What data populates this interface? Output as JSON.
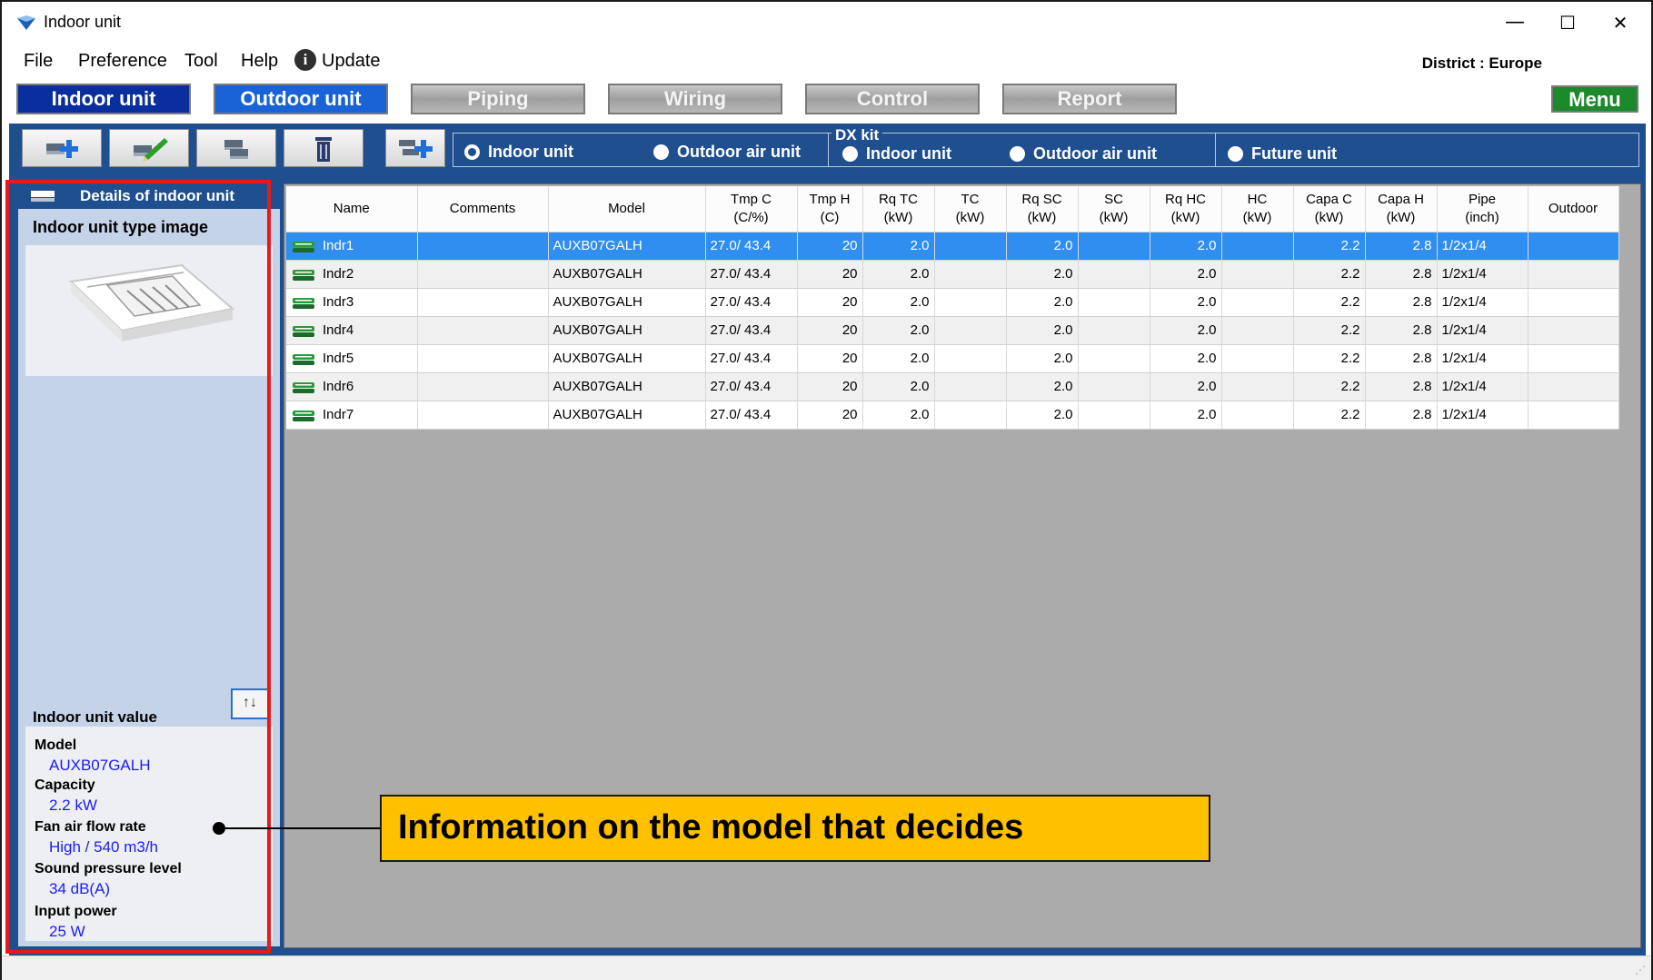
{
  "window": {
    "title": "Indoor unit",
    "controls": {
      "minimize": "—",
      "maximize": "☐",
      "close": "✕"
    }
  },
  "menubar": {
    "items": [
      "File",
      "Preference",
      "Tool",
      "Help",
      "Update"
    ],
    "update_icon": "info-icon",
    "district": "District : Europe"
  },
  "nav": {
    "tabs": [
      {
        "label": "Indoor unit",
        "state": "active"
      },
      {
        "label": "Outdoor unit",
        "state": "enabled"
      },
      {
        "label": "Piping",
        "state": "disabled"
      },
      {
        "label": "Wiring",
        "state": "disabled"
      },
      {
        "label": "Control",
        "state": "disabled"
      },
      {
        "label": "Report",
        "state": "disabled"
      }
    ],
    "menu_label": "Menu"
  },
  "toolbar": {
    "buttons": [
      "add-unit-icon",
      "edit-unit-icon",
      "copy-unit-icon",
      "delete-icon",
      "add-multiple-icon"
    ],
    "dx_kit_label": "DX kit",
    "radios": [
      {
        "label": "Indoor unit",
        "checked": true
      },
      {
        "label": "Outdoor air unit",
        "checked": false
      },
      {
        "label": "Indoor unit",
        "checked": false
      },
      {
        "label": "Outdoor air unit",
        "checked": false
      },
      {
        "label": "Future unit",
        "checked": false
      }
    ]
  },
  "details": {
    "title": "Details of indoor unit",
    "type_image_label": "Indoor unit type image",
    "value_label": "Indoor unit value",
    "sort_icon": "↑↓",
    "values": [
      {
        "label": "Model",
        "value": "AUXB07GALH"
      },
      {
        "label": "Capacity",
        "value": "2.2 kW"
      },
      {
        "label": "Fan air flow rate",
        "value": "High / 540 m3/h"
      },
      {
        "label": "Sound pressure level",
        "value": "34 dB(A)"
      },
      {
        "label": "Input power",
        "value": "25 W"
      }
    ]
  },
  "grid": {
    "columns": [
      {
        "line1": "Name",
        "line2": ""
      },
      {
        "line1": "Comments",
        "line2": ""
      },
      {
        "line1": "Model",
        "line2": ""
      },
      {
        "line1": "Tmp C",
        "line2": "(C/%)"
      },
      {
        "line1": "Tmp H",
        "line2": "(C)"
      },
      {
        "line1": "Rq TC",
        "line2": "(kW)"
      },
      {
        "line1": "TC",
        "line2": "(kW)"
      },
      {
        "line1": "Rq SC",
        "line2": "(kW)"
      },
      {
        "line1": "SC",
        "line2": "(kW)"
      },
      {
        "line1": "Rq HC",
        "line2": "(kW)"
      },
      {
        "line1": "HC",
        "line2": "(kW)"
      },
      {
        "line1": "Capa C",
        "line2": "(kW)"
      },
      {
        "line1": "Capa H",
        "line2": "(kW)"
      },
      {
        "line1": "Pipe",
        "line2": "(inch)"
      },
      {
        "line1": "Outdoor",
        "line2": ""
      }
    ],
    "rows": [
      [
        "Indr1",
        "",
        "AUXB07GALH",
        "27.0/ 43.4",
        "20",
        "2.0",
        "",
        "2.0",
        "",
        "2.0",
        "",
        "2.2",
        "2.8",
        "1/2x1/4",
        ""
      ],
      [
        "Indr2",
        "",
        "AUXB07GALH",
        "27.0/ 43.4",
        "20",
        "2.0",
        "",
        "2.0",
        "",
        "2.0",
        "",
        "2.2",
        "2.8",
        "1/2x1/4",
        ""
      ],
      [
        "Indr3",
        "",
        "AUXB07GALH",
        "27.0/ 43.4",
        "20",
        "2.0",
        "",
        "2.0",
        "",
        "2.0",
        "",
        "2.2",
        "2.8",
        "1/2x1/4",
        ""
      ],
      [
        "Indr4",
        "",
        "AUXB07GALH",
        "27.0/ 43.4",
        "20",
        "2.0",
        "",
        "2.0",
        "",
        "2.0",
        "",
        "2.2",
        "2.8",
        "1/2x1/4",
        ""
      ],
      [
        "Indr5",
        "",
        "AUXB07GALH",
        "27.0/ 43.4",
        "20",
        "2.0",
        "",
        "2.0",
        "",
        "2.0",
        "",
        "2.2",
        "2.8",
        "1/2x1/4",
        ""
      ],
      [
        "Indr6",
        "",
        "AUXB07GALH",
        "27.0/ 43.4",
        "20",
        "2.0",
        "",
        "2.0",
        "",
        "2.0",
        "",
        "2.2",
        "2.8",
        "1/2x1/4",
        ""
      ],
      [
        "Indr7",
        "",
        "AUXB07GALH",
        "27.0/ 43.4",
        "20",
        "2.0",
        "",
        "2.0",
        "",
        "2.0",
        "",
        "2.2",
        "2.8",
        "1/2x1/4",
        ""
      ]
    ],
    "selected_row": 0,
    "row_icon": "indoor-unit-icon"
  },
  "callout": {
    "text": "Information on the model that decides"
  },
  "colors": {
    "panel_blue": "#1f4f8f",
    "selection_blue": "#2f8ef0",
    "callout_yellow": "#ffc000",
    "highlight_red": "#e61a1a",
    "menu_green": "#1c8a2c",
    "value_blue": "#1a1aff"
  }
}
